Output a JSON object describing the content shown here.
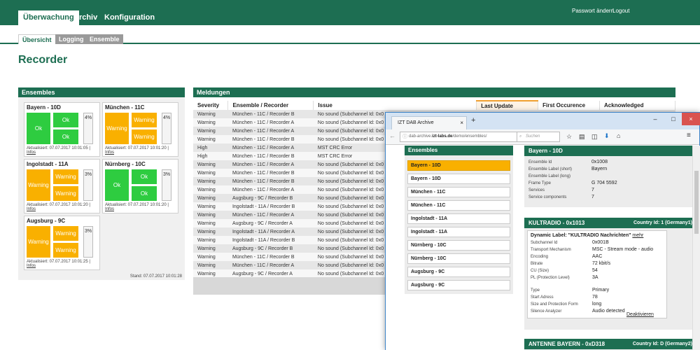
{
  "nav": {
    "tabs": [
      "Überwachung",
      "Archiv",
      "Konfiguration"
    ],
    "links": [
      "Passwort ändern",
      "Logout"
    ],
    "subtabs": [
      "Übersicht",
      "Logging",
      "Ensemble"
    ]
  },
  "page_title": "Recorder",
  "ensembles": {
    "header": "Ensembles",
    "cards": [
      {
        "name": "Bayern - 10D",
        "blocks": [
          "Ok",
          "Ok",
          "Ok"
        ],
        "status": "ok",
        "meter": "4%",
        "updated": "Aktualisiert: 07.07.2017 10:01:05 |",
        "info": "Infos"
      },
      {
        "name": "München - 11C",
        "blocks": [
          "Warning",
          "Warning",
          "Warning"
        ],
        "status": "warn",
        "meter": "4%",
        "updated": "Aktualisiert: 07.07.2017 10:01:20 |",
        "info": "Infos"
      },
      {
        "name": "Ingolstadt - 11A",
        "blocks": [
          "Warning",
          "Warning",
          "Warning"
        ],
        "status": "warn",
        "meter": "3%",
        "updated": "Aktualisiert: 07.07.2017 10:01:20 |",
        "info": "Infos"
      },
      {
        "name": "Nürnberg - 10C",
        "blocks": [
          "Ok",
          "Ok",
          "Ok"
        ],
        "status": "ok",
        "meter": "3%",
        "updated": "Aktualisiert: 07.07.2017 10:01:20 |",
        "info": "Infos"
      },
      {
        "name": "Augsburg - 9C",
        "blocks": [
          "Warning",
          "Warning",
          "Warning"
        ],
        "status": "warn",
        "meter": "3%",
        "updated": "Aktualisiert: 07.07.2017 10:01:25 |",
        "info": "Infos"
      }
    ],
    "stand": "Stand: 07.07.2017 10:01:28"
  },
  "meldungen": {
    "header": "Meldungen",
    "columns": [
      "Severity",
      "Ensemble / Recorder",
      "Issue",
      "Last Update",
      "First Occurence",
      "Acknowledged"
    ],
    "rows": [
      [
        "Warning",
        "München - 11C / Recorder B",
        "No sound (Subchannel Id: 0x0"
      ],
      [
        "Warning",
        "München - 11C / Recorder A",
        "No sound (Subchannel Id: 0x0"
      ],
      [
        "Warning",
        "München - 11C / Recorder A",
        "No sound (Subchannel Id: 0x0"
      ],
      [
        "Warning",
        "München - 11C / Recorder B",
        "No sound (Subchannel Id: 0x0"
      ],
      [
        "High",
        "München - 11C / Recorder A",
        "MST CRC Error"
      ],
      [
        "High",
        "München - 11C / Recorder B",
        "MST CRC Error"
      ],
      [
        "Warning",
        "München - 11C / Recorder A",
        "No sound (Subchannel Id: 0x0"
      ],
      [
        "Warning",
        "München - 11C / Recorder B",
        "No sound (Subchannel Id: 0x0"
      ],
      [
        "Warning",
        "München - 11C / Recorder B",
        "No sound (Subchannel Id: 0x0"
      ],
      [
        "Warning",
        "München - 11C / Recorder A",
        "No sound (Subchannel Id: 0x0"
      ],
      [
        "Warning",
        "Augsburg - 9C / Recorder B",
        "No sound (Subchannel Id: 0x0"
      ],
      [
        "Warning",
        "Ingolstadt - 11A / Recorder B",
        "No sound (Subchannel Id: 0x0"
      ],
      [
        "Warning",
        "München - 11C / Recorder A",
        "No sound (Subchannel Id: 0x0"
      ],
      [
        "Warning",
        "Augsburg - 9C / Recorder A",
        "No sound (Subchannel Id: 0x0"
      ],
      [
        "Warning",
        "Ingolstadt - 11A / Recorder A",
        "No sound (Subchannel Id: 0x0"
      ],
      [
        "Warning",
        "Ingolstadt - 11A / Recorder B",
        "No sound (Subchannel Id: 0x0"
      ],
      [
        "Warning",
        "Augsburg - 9C / Recorder B",
        "No sound (Subchannel Id: 0x0"
      ],
      [
        "Warning",
        "München - 11C / Recorder B",
        "No sound (Subchannel Id: 0x0"
      ],
      [
        "Warning",
        "München - 11C / Recorder A",
        "No sound (Subchannel Id: 0x0"
      ],
      [
        "Warning",
        "Augsburg - 9C / Recorder A",
        "No sound (Subchannel Id: 0x0"
      ]
    ]
  },
  "browser": {
    "tab_title": "IZT DAB Archive",
    "url_prefix": "dab-archive.",
    "url_domain": "izt-labs.de",
    "url_path": "/demo/ensembles/",
    "search_placeholder": "Suchen",
    "ensembles_header": "Ensembles",
    "ensemble_list": [
      "Bayern - 10D",
      "Bayern - 10D",
      "München - 11C",
      "München - 11C",
      "Ingolstadt - 11A",
      "Ingolstadt - 11A",
      "Nürnberg - 10C",
      "Nürnberg - 10C",
      "Augsburg - 9C",
      "Augsburg - 9C"
    ],
    "detail_header": "Bayern - 10D",
    "detail": [
      [
        "Ensemble Id",
        "0x1008"
      ],
      [
        "Ensemble Label (short)",
        "Bayern"
      ],
      [
        "Ensemble Label (long)",
        ""
      ],
      [
        "Frame Type",
        "G 704 5592"
      ],
      [
        "Services",
        "7"
      ],
      [
        "Service components",
        "7"
      ]
    ],
    "service1": {
      "header": "KULTRADIO - 0x1013",
      "country": "Country Id: 1 (Germany1)",
      "dynamic_label": "Dynamic Label: \"KULTRADIO Nachrichten\"",
      "more": "mehr",
      "fields": [
        [
          "Subchannel Id",
          "0x001B"
        ],
        [
          "Transport Mechanism",
          "MSC - Stream mode - audio"
        ],
        [
          "Encoding",
          "AAC"
        ],
        [
          "Bitrate",
          "72 kbit/s"
        ],
        [
          "CU (Size)",
          "54"
        ],
        [
          "PL (Protection Level)",
          "3A"
        ],
        [
          "Type",
          "Primary"
        ],
        [
          "Start Adress",
          "78"
        ],
        [
          "Size and Protection Form",
          "long"
        ],
        [
          "Silence Analyzer",
          "Audio detected"
        ]
      ],
      "deactivate": "Deaktivieren"
    },
    "service2": {
      "header": "ANTENNE BAYERN - 0xD318",
      "country": "Country Id: D (Germany2)"
    }
  }
}
